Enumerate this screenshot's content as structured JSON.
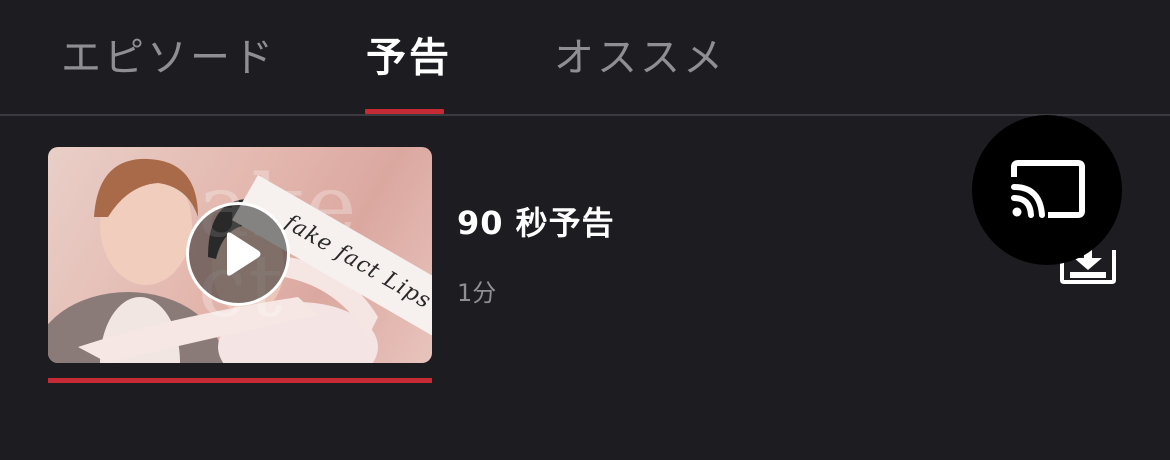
{
  "tabs": [
    {
      "label": "エピソード",
      "active": false
    },
    {
      "label": "予告",
      "active": true
    },
    {
      "label": "オススメ",
      "active": false
    }
  ],
  "episode": {
    "title": "90 秒予告",
    "duration": "1分",
    "thumbnail_logo_text": "fake fact Lips",
    "watch_progress": 1.0
  },
  "icons": {
    "play": "play-icon",
    "download": "download-icon",
    "cast": "cast-icon"
  },
  "colors": {
    "background": "#1c1c21",
    "accent": "#c62a35",
    "inactive_text": "#8e8e93"
  }
}
